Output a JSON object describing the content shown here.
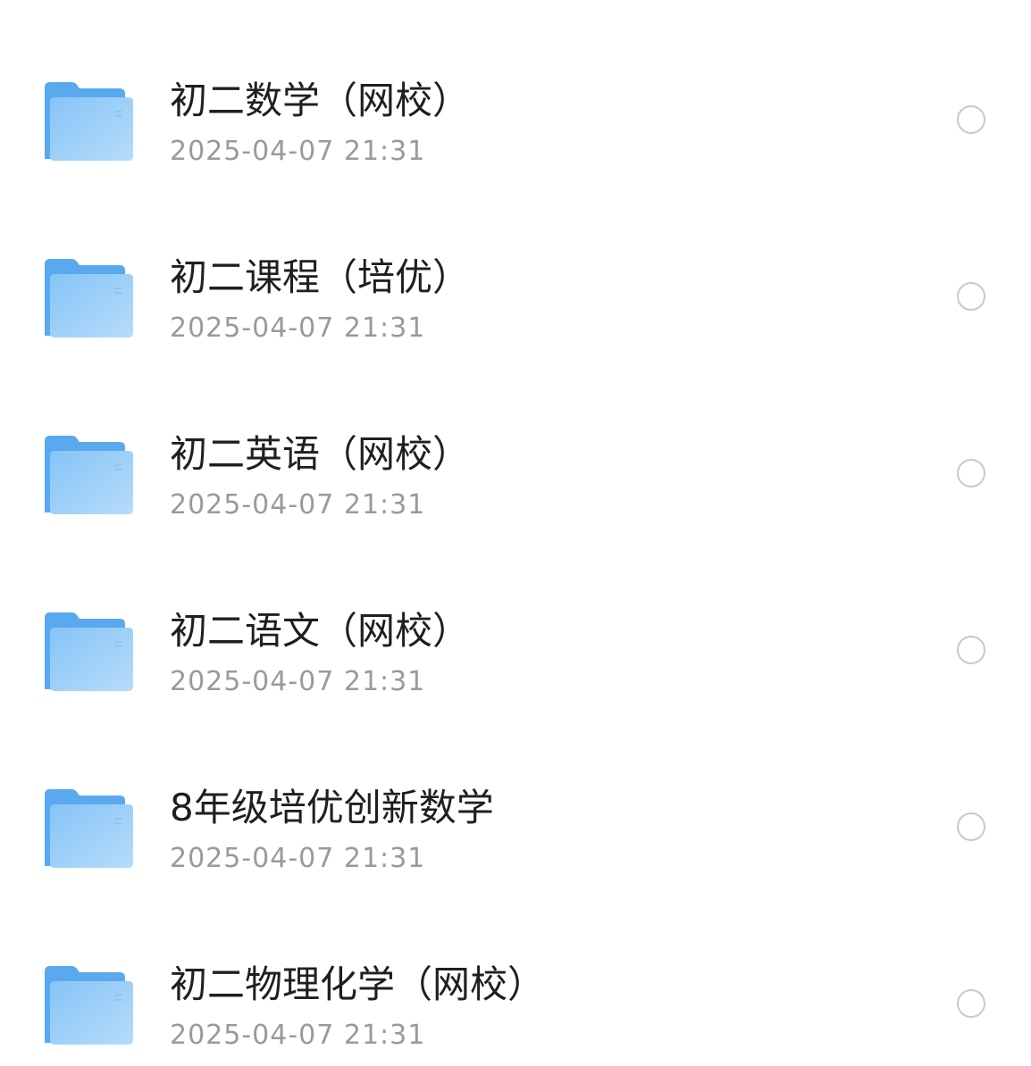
{
  "files": [
    {
      "name": "初二数学（网校）",
      "date": "2025-04-07 21:31",
      "icon": "folder-icon"
    },
    {
      "name": "初二课程（培优）",
      "date": "2025-04-07 21:31",
      "icon": "folder-icon"
    },
    {
      "name": "初二英语（网校）",
      "date": "2025-04-07 21:31",
      "icon": "folder-icon"
    },
    {
      "name": "初二语文（网校）",
      "date": "2025-04-07 21:31",
      "icon": "folder-icon"
    },
    {
      "name": "8年级培优创新数学",
      "date": "2025-04-07 21:31",
      "icon": "folder-icon"
    },
    {
      "name": "初二物理化学（网校）",
      "date": "2025-04-07 21:31",
      "icon": "folder-icon"
    }
  ],
  "colors": {
    "folder_back": "#5aa9ef",
    "folder_front_top": "#7fc0f6",
    "folder_front_bottom": "#b3daf9",
    "name_text": "#1f1f1f",
    "date_text": "#9a9a9a",
    "radio_border": "#c9c9c9"
  }
}
